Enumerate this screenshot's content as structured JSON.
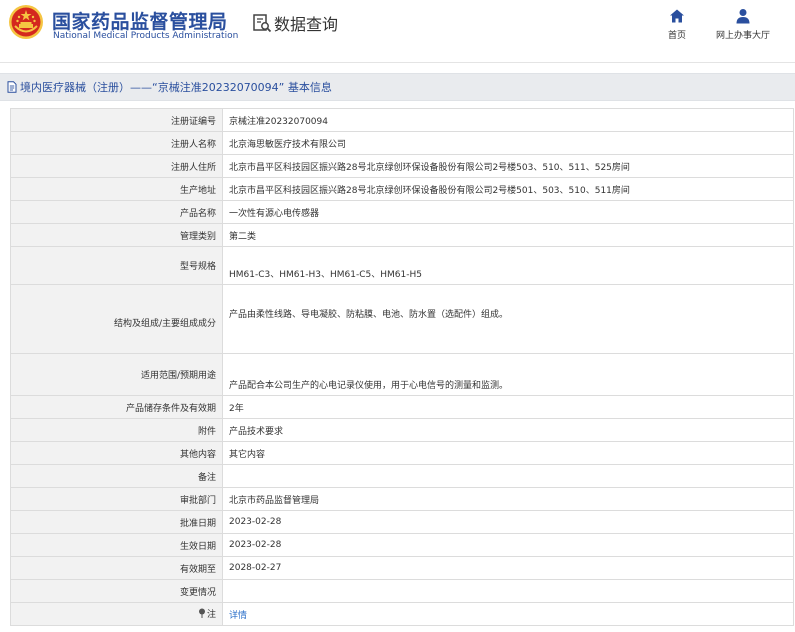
{
  "header": {
    "org_name_cn": "国家药品监督管理局",
    "org_name_en": "National Medical Products Administration",
    "query_title": "数据查询",
    "nav": [
      {
        "label": "首页",
        "icon": "home-icon"
      },
      {
        "label": "网上办事大厅",
        "icon": "user-icon"
      }
    ]
  },
  "title_bar": {
    "text": "境内医疗器械（注册）——“京械注准20232070094” 基本信息",
    "icon": "document-icon"
  },
  "fields": [
    {
      "label": "注册证编号",
      "value": "京械注准20232070094"
    },
    {
      "label": "注册人名称",
      "value": "北京海思敏医疗技术有限公司"
    },
    {
      "label": "注册人住所",
      "value": "北京市昌平区科技园区振兴路28号北京绿创环保设备股份有限公司2号楼503、510、511、525房间"
    },
    {
      "label": "生产地址",
      "value": "北京市昌平区科技园区振兴路28号北京绿创环保设备股份有限公司2号楼501、503、510、511房间"
    },
    {
      "label": "产品名称",
      "value": "一次性有源心电传感器"
    },
    {
      "label": "管理类别",
      "value": "第二类"
    },
    {
      "label": "型号规格",
      "value": "HM61-C3、HM61-H3、HM61-C5、HM61-H5"
    },
    {
      "label": "结构及组成/主要组成成分",
      "value": "产品由柔性线路、导电凝胶、防粘膜、电池、防水置（选配件）组成。"
    },
    {
      "label": "适用范围/预期用途",
      "value": "产品配合本公司生产的心电记录仪使用，用于心电信号的测量和监测。"
    },
    {
      "label": "产品储存条件及有效期",
      "value": "2年"
    },
    {
      "label": "附件",
      "value": "产品技术要求"
    },
    {
      "label": "其他内容",
      "value": "其它内容"
    },
    {
      "label": "备注",
      "value": ""
    },
    {
      "label": "审批部门",
      "value": "北京市药品监督管理局"
    },
    {
      "label": "批准日期",
      "value": "2023-02-28"
    },
    {
      "label": "生效日期",
      "value": "2023-02-28"
    },
    {
      "label": "有效期至",
      "value": "2028-02-27"
    },
    {
      "label": "变更情况",
      "value": ""
    },
    {
      "label": "注",
      "value": "详情"
    }
  ],
  "colors": {
    "brand_blue": "#2a4f9e",
    "link_blue": "#2a6fc9",
    "key_bg": "#f2f2f2",
    "emblem_red": "#d4281e",
    "emblem_gold": "#f5c542"
  }
}
